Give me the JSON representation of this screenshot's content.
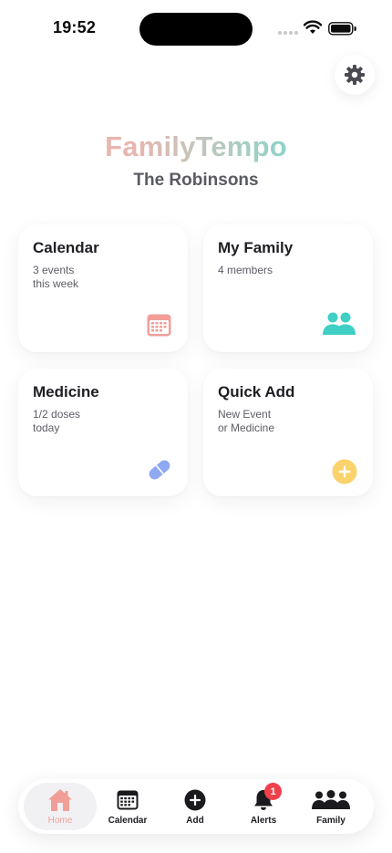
{
  "status_bar": {
    "time": "19:52"
  },
  "header": {
    "app_title": "FamilyTempo",
    "family_name": "The Robinsons"
  },
  "cards": [
    {
      "title": "Calendar",
      "sub1": "3 events",
      "sub2": "this week",
      "icon": "calendar-icon",
      "color": "#f29e98"
    },
    {
      "title": "My Family",
      "sub1": "4 members",
      "sub2": "",
      "icon": "people-icon",
      "color": "#3fcfc4"
    },
    {
      "title": "Medicine",
      "sub1": "1/2 doses",
      "sub2": "today",
      "icon": "pill-icon",
      "color": "#8fa8f2"
    },
    {
      "title": "Quick Add",
      "sub1": "New Event",
      "sub2": "or Medicine",
      "icon": "plus-circle-icon",
      "color": "#fbd26b"
    }
  ],
  "tabs": [
    {
      "label": "Home",
      "icon": "home-icon",
      "active": true
    },
    {
      "label": "Calendar",
      "icon": "calendar-icon"
    },
    {
      "label": "Add",
      "icon": "plus-circle-icon"
    },
    {
      "label": "Alerts",
      "icon": "bell-icon",
      "badge": "1"
    },
    {
      "label": "Family",
      "icon": "people-icon"
    }
  ],
  "colors": {
    "accent_pink": "#f29e98",
    "accent_teal": "#3fcfc4",
    "badge_red": "#f0404b"
  }
}
